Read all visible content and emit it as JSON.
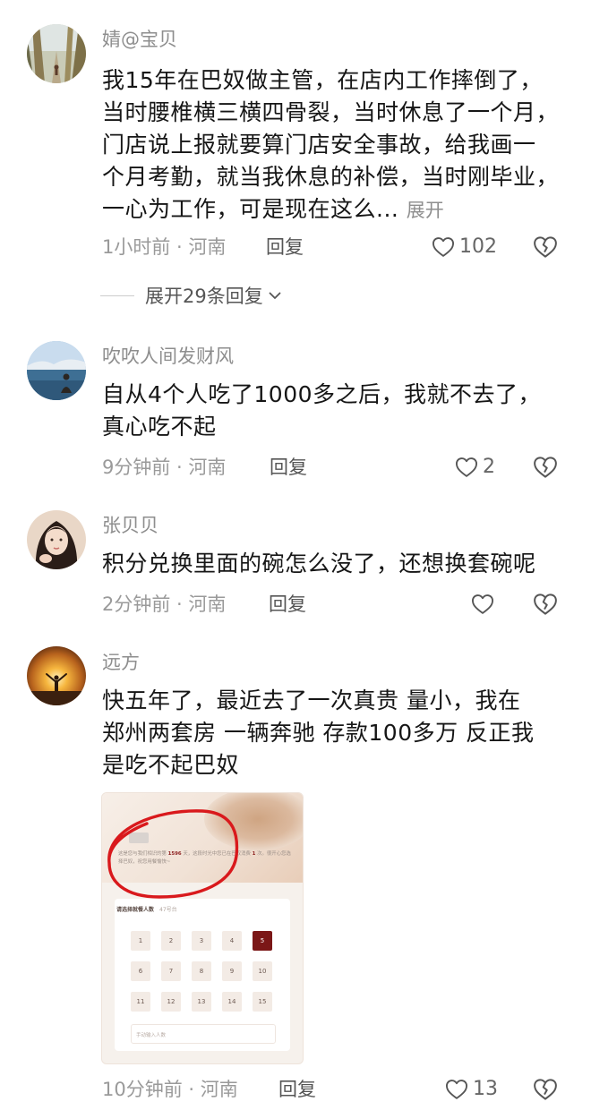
{
  "comments": [
    {
      "username": "婧@宝贝",
      "text_lines": [
        "我15年在巴奴做主管，在店内工作摔倒了，",
        "当时腰椎横三横四骨裂，当时休息了一个月，",
        "门店说上报就要算门店安全事故，给我画一",
        "个月考勤，就当我休息的补偿，当时刚毕业，",
        "一心为工作，可是现在这么..."
      ],
      "expand_label": "展开",
      "time_location": "1小时前 · 河南",
      "reply_label": "回复",
      "likes": "102",
      "avatar_icon": "forest-path-avatar"
    },
    {
      "username": "吹吹人间发财风",
      "text_lines": [
        "自从4个人吃了1000多之后，我就不去了，",
        "真心吃不起"
      ],
      "time_location": "9分钟前 · 河南",
      "reply_label": "回复",
      "likes": "2",
      "avatar_icon": "lakeside-person-avatar"
    },
    {
      "username": "张贝贝",
      "text_lines": [
        "积分兑换里面的碗怎么没了，还想换套碗呢"
      ],
      "time_location": "2分钟前 · 河南",
      "reply_label": "回复",
      "likes": "",
      "avatar_icon": "girl-portrait-avatar"
    },
    {
      "username": "远方",
      "text_lines": [
        "快五年了，最近去了一次真贵 量小，我在",
        "郑州两套房 一辆奔驰 存款100多万 反正我",
        "是吃不起巴奴"
      ],
      "time_location": "10分钟前 · 河南",
      "reply_label": "回复",
      "likes": "13",
      "avatar_icon": "sunset-silhouette-avatar"
    }
  ],
  "expand_replies_label": "展开29条回复",
  "attached_image": {
    "notice_prefix": "这是您与我们相识的第",
    "days": "1596",
    "notice_mid": "天，这段时光中您已在巴奴消费",
    "visits": "1",
    "notice_suffix": "次。很开心您选择巴奴，祝您用餐愉快~",
    "select_label": "请选择就餐人数",
    "select_hint": "47号台",
    "numbers": [
      "1",
      "2",
      "3",
      "4",
      "5",
      "6",
      "7",
      "8",
      "9",
      "10",
      "11",
      "12",
      "13",
      "14",
      "15"
    ],
    "selected": "5",
    "input_placeholder": "手动输入人数"
  },
  "colors": {
    "text": "#161616",
    "meta": "#9a9a9a",
    "accent_red": "#d9191c",
    "selected_cell": "#7b1717"
  }
}
